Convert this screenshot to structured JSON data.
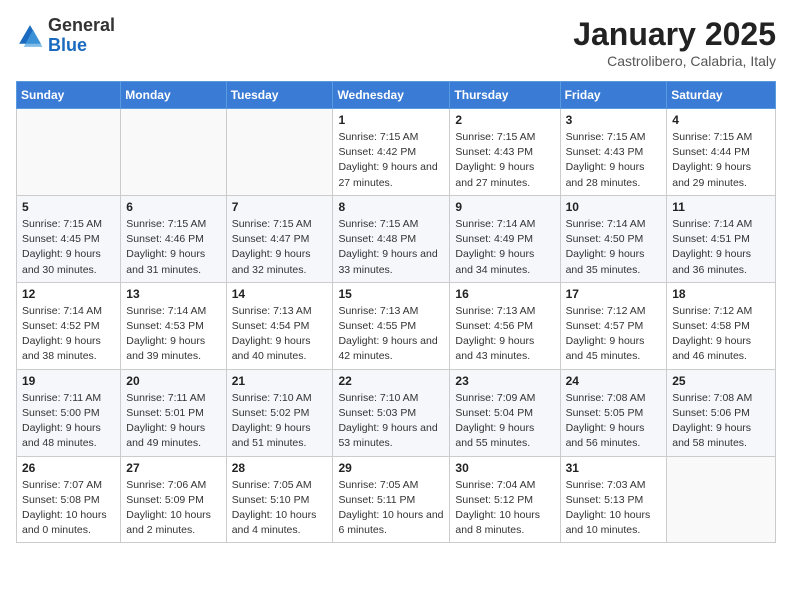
{
  "header": {
    "logo_general": "General",
    "logo_blue": "Blue",
    "title": "January 2025",
    "subtitle": "Castrolibero, Calabria, Italy"
  },
  "weekdays": [
    "Sunday",
    "Monday",
    "Tuesday",
    "Wednesday",
    "Thursday",
    "Friday",
    "Saturday"
  ],
  "weeks": [
    [
      {
        "day": "",
        "info": ""
      },
      {
        "day": "",
        "info": ""
      },
      {
        "day": "",
        "info": ""
      },
      {
        "day": "1",
        "info": "Sunrise: 7:15 AM\nSunset: 4:42 PM\nDaylight: 9 hours and 27 minutes."
      },
      {
        "day": "2",
        "info": "Sunrise: 7:15 AM\nSunset: 4:43 PM\nDaylight: 9 hours and 27 minutes."
      },
      {
        "day": "3",
        "info": "Sunrise: 7:15 AM\nSunset: 4:43 PM\nDaylight: 9 hours and 28 minutes."
      },
      {
        "day": "4",
        "info": "Sunrise: 7:15 AM\nSunset: 4:44 PM\nDaylight: 9 hours and 29 minutes."
      }
    ],
    [
      {
        "day": "5",
        "info": "Sunrise: 7:15 AM\nSunset: 4:45 PM\nDaylight: 9 hours and 30 minutes."
      },
      {
        "day": "6",
        "info": "Sunrise: 7:15 AM\nSunset: 4:46 PM\nDaylight: 9 hours and 31 minutes."
      },
      {
        "day": "7",
        "info": "Sunrise: 7:15 AM\nSunset: 4:47 PM\nDaylight: 9 hours and 32 minutes."
      },
      {
        "day": "8",
        "info": "Sunrise: 7:15 AM\nSunset: 4:48 PM\nDaylight: 9 hours and 33 minutes."
      },
      {
        "day": "9",
        "info": "Sunrise: 7:14 AM\nSunset: 4:49 PM\nDaylight: 9 hours and 34 minutes."
      },
      {
        "day": "10",
        "info": "Sunrise: 7:14 AM\nSunset: 4:50 PM\nDaylight: 9 hours and 35 minutes."
      },
      {
        "day": "11",
        "info": "Sunrise: 7:14 AM\nSunset: 4:51 PM\nDaylight: 9 hours and 36 minutes."
      }
    ],
    [
      {
        "day": "12",
        "info": "Sunrise: 7:14 AM\nSunset: 4:52 PM\nDaylight: 9 hours and 38 minutes."
      },
      {
        "day": "13",
        "info": "Sunrise: 7:14 AM\nSunset: 4:53 PM\nDaylight: 9 hours and 39 minutes."
      },
      {
        "day": "14",
        "info": "Sunrise: 7:13 AM\nSunset: 4:54 PM\nDaylight: 9 hours and 40 minutes."
      },
      {
        "day": "15",
        "info": "Sunrise: 7:13 AM\nSunset: 4:55 PM\nDaylight: 9 hours and 42 minutes."
      },
      {
        "day": "16",
        "info": "Sunrise: 7:13 AM\nSunset: 4:56 PM\nDaylight: 9 hours and 43 minutes."
      },
      {
        "day": "17",
        "info": "Sunrise: 7:12 AM\nSunset: 4:57 PM\nDaylight: 9 hours and 45 minutes."
      },
      {
        "day": "18",
        "info": "Sunrise: 7:12 AM\nSunset: 4:58 PM\nDaylight: 9 hours and 46 minutes."
      }
    ],
    [
      {
        "day": "19",
        "info": "Sunrise: 7:11 AM\nSunset: 5:00 PM\nDaylight: 9 hours and 48 minutes."
      },
      {
        "day": "20",
        "info": "Sunrise: 7:11 AM\nSunset: 5:01 PM\nDaylight: 9 hours and 49 minutes."
      },
      {
        "day": "21",
        "info": "Sunrise: 7:10 AM\nSunset: 5:02 PM\nDaylight: 9 hours and 51 minutes."
      },
      {
        "day": "22",
        "info": "Sunrise: 7:10 AM\nSunset: 5:03 PM\nDaylight: 9 hours and 53 minutes."
      },
      {
        "day": "23",
        "info": "Sunrise: 7:09 AM\nSunset: 5:04 PM\nDaylight: 9 hours and 55 minutes."
      },
      {
        "day": "24",
        "info": "Sunrise: 7:08 AM\nSunset: 5:05 PM\nDaylight: 9 hours and 56 minutes."
      },
      {
        "day": "25",
        "info": "Sunrise: 7:08 AM\nSunset: 5:06 PM\nDaylight: 9 hours and 58 minutes."
      }
    ],
    [
      {
        "day": "26",
        "info": "Sunrise: 7:07 AM\nSunset: 5:08 PM\nDaylight: 10 hours and 0 minutes."
      },
      {
        "day": "27",
        "info": "Sunrise: 7:06 AM\nSunset: 5:09 PM\nDaylight: 10 hours and 2 minutes."
      },
      {
        "day": "28",
        "info": "Sunrise: 7:05 AM\nSunset: 5:10 PM\nDaylight: 10 hours and 4 minutes."
      },
      {
        "day": "29",
        "info": "Sunrise: 7:05 AM\nSunset: 5:11 PM\nDaylight: 10 hours and 6 minutes."
      },
      {
        "day": "30",
        "info": "Sunrise: 7:04 AM\nSunset: 5:12 PM\nDaylight: 10 hours and 8 minutes."
      },
      {
        "day": "31",
        "info": "Sunrise: 7:03 AM\nSunset: 5:13 PM\nDaylight: 10 hours and 10 minutes."
      },
      {
        "day": "",
        "info": ""
      }
    ]
  ]
}
